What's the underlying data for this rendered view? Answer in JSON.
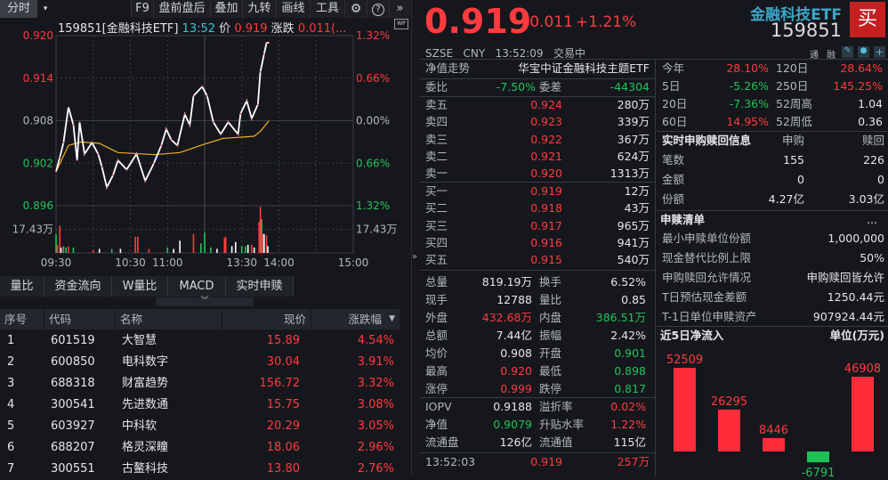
{
  "toolbar": {
    "mode_tab": "分时",
    "items": [
      "F9",
      "盘前盘后",
      "叠加",
      "九转",
      "画线",
      "工具"
    ],
    "icons": [
      "gear-icon",
      "help-icon",
      "expand-icon"
    ]
  },
  "chart_info": {
    "code_name": "159851[金融科技ETF]",
    "time": "13:52",
    "price_label": "价",
    "price": "0.919",
    "change_label": "涨跌",
    "change": "0.011(..."
  },
  "colors": {
    "up": "#ff3b3f",
    "down": "#22c25a",
    "avg_line": "#f0b020",
    "price_line": "#ffffff",
    "accent": "#3fc3cc",
    "buy_button": "#c4201f"
  },
  "chart_data": {
    "type": "line",
    "y_left_ticks": [
      "0.920",
      "0.914",
      "0.908",
      "0.902",
      "0.896"
    ],
    "y_right_ticks": [
      "1.32%",
      "0.66%",
      "0.00%",
      "0.66%",
      "1.32%"
    ],
    "volume_tick": "17.43万",
    "x_ticks": [
      "09:30",
      "10:30",
      "11:00",
      "13:30",
      "14:00",
      "15:00"
    ],
    "ylim": [
      0.896,
      0.92
    ],
    "prev_close": 0.908,
    "price": [
      [
        "09:30",
        0.9008
      ],
      [
        "09:33",
        0.9028
      ],
      [
        "09:36",
        0.9049
      ],
      [
        "09:40",
        0.9099
      ],
      [
        "09:44",
        0.9074
      ],
      [
        "09:47",
        0.9024
      ],
      [
        "09:49",
        0.9078
      ],
      [
        "09:53",
        0.9033
      ],
      [
        "09:59",
        0.9049
      ],
      [
        "10:04",
        0.9033
      ],
      [
        "10:07",
        0.9015
      ],
      [
        "10:11",
        0.8986
      ],
      [
        "10:16",
        0.9003
      ],
      [
        "10:20",
        0.9024
      ],
      [
        "10:27",
        0.9011
      ],
      [
        "10:35",
        0.9033
      ],
      [
        "10:42",
        0.8995
      ],
      [
        "10:49",
        0.902
      ],
      [
        "10:55",
        0.9045
      ],
      [
        "10:59",
        0.9068
      ],
      [
        "11:03",
        0.9053
      ],
      [
        "11:08",
        0.9045
      ],
      [
        "11:14",
        0.9089
      ],
      [
        "11:18",
        0.9074
      ],
      [
        "11:21",
        0.9115
      ],
      [
        "11:28",
        0.9128
      ],
      [
        "13:02",
        0.9115
      ],
      [
        "13:07",
        0.9078
      ],
      [
        "13:13",
        0.9061
      ],
      [
        "13:19",
        0.9078
      ],
      [
        "13:27",
        0.9061
      ],
      [
        "13:29",
        0.909
      ],
      [
        "13:34",
        0.9108
      ],
      [
        "13:38",
        0.9083
      ],
      [
        "13:43",
        0.9103
      ],
      [
        "13:45",
        0.9149
      ],
      [
        "13:48",
        0.9174
      ],
      [
        "13:50",
        0.919
      ],
      [
        "13:52",
        0.919
      ]
    ],
    "average": [
      [
        "09:30",
        0.9008
      ],
      [
        "09:40",
        0.9045
      ],
      [
        "09:50",
        0.905
      ],
      [
        "10:05",
        0.9048
      ],
      [
        "10:20",
        0.9035
      ],
      [
        "10:50",
        0.9032
      ],
      [
        "11:10",
        0.9035
      ],
      [
        "11:30",
        0.9047
      ],
      [
        "13:15",
        0.9055
      ],
      [
        "13:40",
        0.9058
      ],
      [
        "13:45",
        0.9065
      ],
      [
        "13:52",
        0.908
      ]
    ],
    "volume_wan": [
      [
        "09:30",
        14,
        "down"
      ],
      [
        "09:31",
        6,
        "up"
      ],
      [
        "09:33",
        20,
        "up"
      ],
      [
        "09:34",
        4,
        "flat"
      ],
      [
        "09:36",
        5,
        "down"
      ],
      [
        "09:38",
        4,
        "down"
      ],
      [
        "09:40",
        5,
        "up"
      ],
      [
        "09:44",
        4,
        "down"
      ],
      [
        "10:00",
        2,
        "up"
      ],
      [
        "10:05",
        3,
        "flat"
      ],
      [
        "10:15",
        3,
        "down"
      ],
      [
        "10:22",
        3,
        "flat"
      ],
      [
        "10:34",
        12,
        "up"
      ],
      [
        "10:36",
        12,
        "up"
      ],
      [
        "10:45",
        3,
        "up"
      ],
      [
        "11:00",
        4,
        "down"
      ],
      [
        "11:05",
        3,
        "flat"
      ],
      [
        "11:10",
        9,
        "flat"
      ],
      [
        "11:21",
        14,
        "up"
      ],
      [
        "11:27",
        7,
        "down"
      ],
      [
        "13:00",
        15,
        "down"
      ],
      [
        "13:05",
        4,
        "down"
      ],
      [
        "13:10",
        3,
        "flat"
      ],
      [
        "13:16",
        11,
        "up"
      ],
      [
        "13:17",
        12,
        "up"
      ],
      [
        "13:22",
        5,
        "flat"
      ],
      [
        "13:25",
        8,
        "flat"
      ],
      [
        "13:30",
        5,
        "down"
      ],
      [
        "13:33",
        5,
        "down"
      ],
      [
        "13:35",
        6,
        "flat"
      ],
      [
        "13:38",
        6,
        "up"
      ],
      [
        "13:40",
        4,
        "flat"
      ],
      [
        "13:44",
        23,
        "up"
      ],
      [
        "13:45",
        34,
        "up"
      ],
      [
        "13:46",
        25,
        "down"
      ],
      [
        "13:47",
        14,
        "up"
      ],
      [
        "13:48",
        14,
        "flat"
      ],
      [
        "13:50",
        13,
        "up"
      ],
      [
        "13:51",
        5,
        "flat"
      ]
    ]
  },
  "indicator_tabs": [
    "量比",
    "资金流向",
    "W量比",
    "MACD",
    "实时申赎"
  ],
  "table": {
    "headers": [
      "序号",
      "代码",
      "名称",
      "现价",
      "涨跌幅"
    ],
    "rows": [
      [
        "1",
        "601519",
        "大智慧",
        "15.89",
        "4.54%"
      ],
      [
        "2",
        "600850",
        "电科数字",
        "30.04",
        "3.91%"
      ],
      [
        "3",
        "688318",
        "财富趋势",
        "156.72",
        "3.32%"
      ],
      [
        "4",
        "300541",
        "先进数通",
        "15.75",
        "3.08%"
      ],
      [
        "5",
        "603927",
        "中科软",
        "20.29",
        "3.05%"
      ],
      [
        "6",
        "688207",
        "格灵深瞳",
        "18.06",
        "2.96%"
      ],
      [
        "7",
        "300551",
        "古鳌科技",
        "13.80",
        "2.76%"
      ]
    ]
  },
  "quote": {
    "price": "0.919",
    "change": "+0.011",
    "change_pct": "+1.21%",
    "name": "金融科技ETF",
    "code": "159851",
    "buy_label": "买",
    "exchange": "SZSE",
    "currency": "CNY",
    "time": "13:52:09",
    "status": "交易中",
    "tags": [
      "通",
      "融"
    ]
  },
  "nav": {
    "label": "净值走势",
    "fund_name": "华宝中证金融科技主题ETF"
  },
  "ratio": {
    "l1": "委比",
    "v1": "-7.50%",
    "l2": "委差",
    "v2": "-44304"
  },
  "sells": [
    [
      "卖五",
      "0.924",
      "280万"
    ],
    [
      "卖四",
      "0.923",
      "339万"
    ],
    [
      "卖三",
      "0.922",
      "367万"
    ],
    [
      "卖二",
      "0.921",
      "624万"
    ],
    [
      "卖一",
      "0.920",
      "1313万"
    ]
  ],
  "buys": [
    [
      "买一",
      "0.919",
      "12万"
    ],
    [
      "买二",
      "0.918",
      "43万"
    ],
    [
      "买三",
      "0.917",
      "965万"
    ],
    [
      "买四",
      "0.916",
      "941万"
    ],
    [
      "买五",
      "0.915",
      "540万"
    ]
  ],
  "summary": [
    [
      "总量",
      "819.19万",
      "flat",
      "换手",
      "6.52%",
      "flat"
    ],
    [
      "现手",
      "12788",
      "flat",
      "量比",
      "0.85",
      "flat"
    ],
    [
      "外盘",
      "432.68万",
      "up",
      "内盘",
      "386.51万",
      "down"
    ],
    [
      "总额",
      "7.44亿",
      "flat",
      "振幅",
      "2.42%",
      "flat"
    ],
    [
      "均价",
      "0.908",
      "flat",
      "开盘",
      "0.901",
      "down"
    ],
    [
      "最高",
      "0.920",
      "up",
      "最低",
      "0.898",
      "down"
    ],
    [
      "涨停",
      "0.999",
      "up",
      "跌停",
      "0.817",
      "down"
    ]
  ],
  "etf": [
    [
      "IOPV",
      "0.9188",
      "flat",
      "溢折率",
      "0.02%",
      "up"
    ],
    [
      "净值",
      "0.9079",
      "down",
      "升贴水率",
      "1.22%",
      "up"
    ],
    [
      "流通盘",
      "126亿",
      "flat",
      "流通值",
      "115亿",
      "flat"
    ]
  ],
  "ticks": [
    [
      "13:52:03",
      "0.919",
      "257万"
    ]
  ],
  "performance": [
    [
      "今年",
      "28.10%",
      "up",
      "120日",
      "28.64%",
      "up"
    ],
    [
      "5日",
      "-5.26%",
      "down",
      "250日",
      "145.25%",
      "up"
    ],
    [
      "20日",
      "-7.36%",
      "down",
      "52周高",
      "1.04",
      "flat"
    ],
    [
      "60日",
      "14.95%",
      "up",
      "52周低",
      "0.36",
      "flat"
    ]
  ],
  "creation": {
    "title": "实时申购赎回信息",
    "col1": "申购",
    "col2": "赎回",
    "rows": [
      [
        "笔数",
        "155",
        "226"
      ],
      [
        "金额",
        "0",
        "0"
      ],
      [
        "份额",
        "4.27亿",
        "3.03亿"
      ]
    ]
  },
  "creation_list": {
    "title": "申赎清单",
    "more": "...",
    "rows": [
      [
        "最小申赎单位份额",
        "1,000,000"
      ],
      [
        "现金替代比例上限",
        "50%"
      ],
      [
        "申购赎回允许情况",
        "申购赎回皆允许"
      ],
      [
        "T日预估现金差额",
        "1250.44元"
      ],
      [
        "T-1日单位申赎资产",
        "907924.44元"
      ]
    ]
  },
  "net_inflow": {
    "title": "近5日净流入",
    "unit": "单位(万元)",
    "values": [
      52509,
      26295,
      8446,
      -6791,
      46908
    ]
  }
}
